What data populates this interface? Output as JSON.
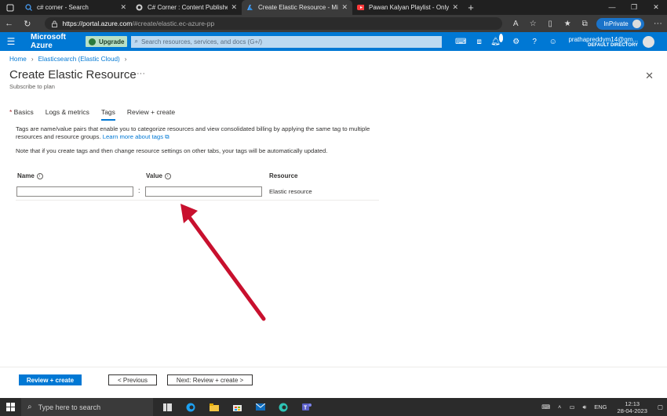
{
  "browser": {
    "tabs": [
      {
        "title": "c# corner - Search",
        "icon": "search-icon",
        "color": "#4aa3ff"
      },
      {
        "title": "C# Corner : Content Publisher",
        "icon": "csharp-corner-icon",
        "color": "#d0d0d0"
      },
      {
        "title": "Create Elastic Resource - Microsoft",
        "icon": "azure-icon",
        "color": "#4aa3ff"
      },
      {
        "title": "Pawan Kalyan Playlist - Only",
        "icon": "youtube-icon",
        "color": "#ff3b3b"
      }
    ],
    "url_host": "https://portal.azure.com",
    "url_path": "/#create/elastic.ec-azure-pp",
    "inprivate_label": "InPrivate"
  },
  "azure": {
    "brand": "Microsoft Azure",
    "upgrade_label": "Upgrade",
    "search_placeholder": "Search resources, services, and docs (G+/)",
    "notifications_count": "1",
    "account_email": "prathapreddym14@gm...",
    "account_directory": "DEFAULT DIRECTORY"
  },
  "page": {
    "breadcrumb": [
      "Home",
      "Elasticsearch (Elastic Cloud)"
    ],
    "title": "Create Elastic Resource",
    "subtitle": "Subscribe to plan",
    "tabs": [
      "Basics",
      "Logs & metrics",
      "Tags",
      "Review + create"
    ],
    "selected_tab": "Tags",
    "description": "Tags are name/value pairs that enable you to categorize resources and view consolidated billing by applying the same tag to multiple resources and resource groups.",
    "learn_more": "Learn more about tags",
    "note": "Note that if you create tags and then change resource settings on other tabs, your tags will be automatically updated.",
    "columns": {
      "name": "Name",
      "value": "Value",
      "resource": "Resource"
    },
    "row": {
      "name": "",
      "value": "",
      "resource": "Elastic resource"
    },
    "buttons": {
      "review": "Review + create",
      "previous": "< Previous",
      "next": "Next: Review + create >"
    }
  },
  "taskbar": {
    "search_placeholder": "Type here to search",
    "language": "ENG",
    "time": "12:13",
    "date": "28-04-2023"
  },
  "colors": {
    "azure_blue": "#0078d4",
    "arrow_red": "#c8102e"
  }
}
